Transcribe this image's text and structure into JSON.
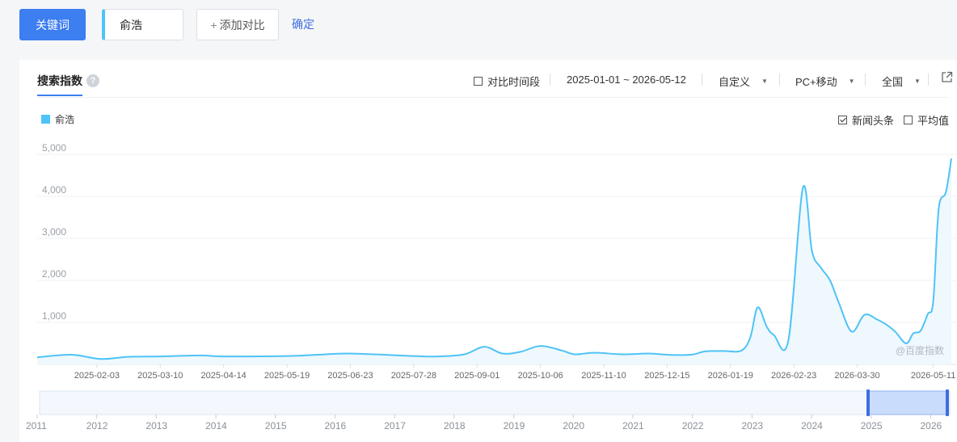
{
  "toolbar": {
    "keyword_button": "关键词",
    "keyword_value": "俞浩",
    "add_compare": "添加对比",
    "confirm": "确定"
  },
  "panel": {
    "tab_label": "搜索指数",
    "help_icon": "question-icon",
    "compare_period_label": "对比时间段",
    "date_range": "2025-01-01 ~ 2026-05-12",
    "custom_label": "自定义",
    "device_label": "PC+移动",
    "region_label": "全国",
    "export_icon": "external-link-icon",
    "news_label": "新闻头条",
    "news_checked": true,
    "average_label": "平均值",
    "average_checked": false,
    "watermark": "@百度指数"
  },
  "colors": {
    "accent": "#3d7ef0",
    "series": "#4fc3f7",
    "area_fill": "#eef8fd"
  },
  "chart_data": {
    "type": "area",
    "title": "",
    "xlabel": "",
    "ylabel": "",
    "ylim": [
      0,
      5000
    ],
    "yticks": [
      1000,
      2000,
      3000,
      4000,
      5000
    ],
    "ytick_labels": [
      "1,000",
      "2,000",
      "3,000",
      "4,000",
      "5,000"
    ],
    "xrange": [
      "2025-01-01",
      "2026-05-12"
    ],
    "xtick_labels": [
      "2025-02-03",
      "2025-03-10",
      "2025-04-14",
      "2025-05-19",
      "2025-06-23",
      "2025-07-28",
      "2025-09-01",
      "2025-10-06",
      "2025-11-10",
      "2025-12-15",
      "2026-01-19",
      "2026-02-23",
      "2026-03-30",
      "2026-05-11"
    ],
    "grid": true,
    "legend": "top-left",
    "series": [
      {
        "name": "俞浩",
        "points": [
          [
            "2025-01-01",
            170
          ],
          [
            "2025-01-20",
            230
          ],
          [
            "2025-02-05",
            130
          ],
          [
            "2025-02-20",
            180
          ],
          [
            "2025-03-10",
            190
          ],
          [
            "2025-04-01",
            215
          ],
          [
            "2025-04-14",
            190
          ],
          [
            "2025-05-19",
            200
          ],
          [
            "2025-06-05",
            230
          ],
          [
            "2025-06-23",
            260
          ],
          [
            "2025-07-28",
            200
          ],
          [
            "2025-08-10",
            190
          ],
          [
            "2025-08-25",
            240
          ],
          [
            "2025-09-05",
            420
          ],
          [
            "2025-09-15",
            260
          ],
          [
            "2025-09-25",
            300
          ],
          [
            "2025-10-06",
            440
          ],
          [
            "2025-10-18",
            330
          ],
          [
            "2025-10-25",
            240
          ],
          [
            "2025-11-05",
            280
          ],
          [
            "2025-11-20",
            240
          ],
          [
            "2025-12-05",
            260
          ],
          [
            "2025-12-15",
            230
          ],
          [
            "2025-12-28",
            230
          ],
          [
            "2026-01-05",
            310
          ],
          [
            "2026-01-15",
            320
          ],
          [
            "2026-01-25",
            330
          ],
          [
            "2026-01-30",
            650
          ],
          [
            "2026-02-03",
            1360
          ],
          [
            "2026-02-08",
            900
          ],
          [
            "2026-02-12",
            700
          ],
          [
            "2026-02-20",
            580
          ],
          [
            "2026-02-28",
            4200
          ],
          [
            "2026-03-05",
            2700
          ],
          [
            "2026-03-10",
            2300
          ],
          [
            "2026-03-15",
            2000
          ],
          [
            "2026-03-20",
            1450
          ],
          [
            "2026-03-27",
            780
          ],
          [
            "2026-04-03",
            1180
          ],
          [
            "2026-04-10",
            1070
          ],
          [
            "2026-04-15",
            950
          ],
          [
            "2026-04-20",
            780
          ],
          [
            "2026-04-26",
            500
          ],
          [
            "2026-04-30",
            740
          ],
          [
            "2026-05-04",
            800
          ],
          [
            "2026-05-08",
            1200
          ],
          [
            "2026-05-11",
            1500
          ],
          [
            "2026-05-14",
            3700
          ],
          [
            "2026-05-18",
            4100
          ],
          [
            "2026-05-21",
            4900
          ]
        ]
      }
    ],
    "overview_years": [
      "2011",
      "2012",
      "2013",
      "2014",
      "2015",
      "2016",
      "2017",
      "2018",
      "2019",
      "2020",
      "2021",
      "2022",
      "2023",
      "2024",
      "2025",
      "2026"
    ]
  }
}
